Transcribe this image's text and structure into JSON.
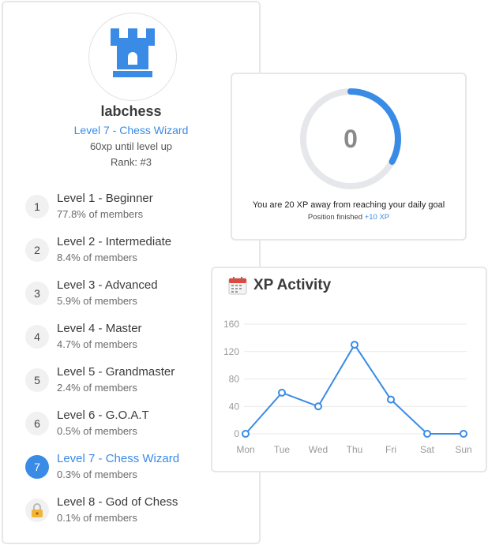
{
  "profile": {
    "username": "labchess",
    "level_title": "Level 7 - Chess Wizard",
    "xp_until": "60xp until level up",
    "rank": "Rank: #3"
  },
  "levels": [
    {
      "num": "1",
      "name": "Level 1 - Beginner",
      "pct": "77.8% of members"
    },
    {
      "num": "2",
      "name": "Level 2 - Intermediate",
      "pct": "8.4% of members"
    },
    {
      "num": "3",
      "name": "Level 3 - Advanced",
      "pct": "5.9% of members"
    },
    {
      "num": "4",
      "name": "Level 4 - Master",
      "pct": "4.7% of members"
    },
    {
      "num": "5",
      "name": "Level 5 - Grandmaster",
      "pct": "2.4% of members"
    },
    {
      "num": "6",
      "name": "Level 6 - G.O.A.T",
      "pct": "0.5% of members"
    },
    {
      "num": "7",
      "name": "Level 7 - Chess Wizard",
      "pct": "0.3% of members",
      "active": true
    },
    {
      "num": "",
      "name": "Level 8 - God of Chess",
      "pct": "0.1% of members",
      "locked": true
    }
  ],
  "daily_goal": {
    "value": "0",
    "progress": 0.33,
    "message": "You are 20 XP away from reaching your daily goal",
    "sub_label": "Position finished",
    "sub_xp": "+10 XP"
  },
  "activity": {
    "title": "XP Activity"
  },
  "colors": {
    "accent": "#3a8be6",
    "ring_track": "#e6e7ea",
    "lock": "#f2b53a"
  },
  "chart_data": {
    "type": "line",
    "categories": [
      "Mon",
      "Tue",
      "Wed",
      "Thu",
      "Fri",
      "Sat",
      "Sun"
    ],
    "series": [
      {
        "values": [
          0,
          60,
          40,
          130,
          50,
          0,
          0
        ]
      }
    ],
    "yticks": [
      0,
      40,
      80,
      120,
      160
    ],
    "ylim": [
      0,
      160
    ],
    "grid": true
  }
}
